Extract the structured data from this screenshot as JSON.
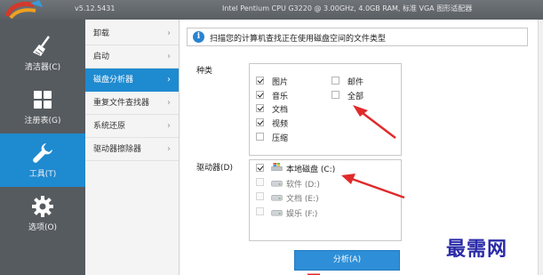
{
  "titlebar": {
    "version": "v5.12.5431",
    "system_info": "Intel Pentium CPU G3220 @ 3.00GHz, 4.0GB RAM, 标准 VGA 图形适配器"
  },
  "sidebar": {
    "items": [
      {
        "label": "清洁器(C)",
        "icon": "broom-icon"
      },
      {
        "label": "注册表(G)",
        "icon": "grid-icon"
      },
      {
        "label": "工具(T)",
        "icon": "wrench-icon",
        "active": true
      },
      {
        "label": "选项(O)",
        "icon": "gear-icon"
      }
    ]
  },
  "subnav": {
    "items": [
      {
        "label": "卸载"
      },
      {
        "label": "启动"
      },
      {
        "label": "磁盘分析器",
        "active": true
      },
      {
        "label": "重复文件查找器"
      },
      {
        "label": "系统还原"
      },
      {
        "label": "驱动器擦除器"
      }
    ]
  },
  "info": {
    "text": "扫描您的计算机查找正在使用磁盘空间的文件类型"
  },
  "categories": {
    "label": "种类",
    "left": [
      {
        "label": "图片",
        "checked": true
      },
      {
        "label": "音乐",
        "checked": true
      },
      {
        "label": "文档",
        "checked": true
      },
      {
        "label": "视频",
        "checked": true
      },
      {
        "label": "压缩",
        "checked": false
      }
    ],
    "right": [
      {
        "label": "邮件",
        "checked": false
      },
      {
        "label": "全部",
        "checked": false
      }
    ]
  },
  "drives": {
    "label": "驱动器(D)",
    "items": [
      {
        "label": "本地磁盘 (C:)",
        "checked": true,
        "enabled": true,
        "icon": "windows-drive-icon"
      },
      {
        "label": "软件 (D:)",
        "checked": false,
        "enabled": false,
        "icon": "drive-icon"
      },
      {
        "label": "文档 (E:)",
        "checked": false,
        "enabled": false,
        "icon": "drive-icon"
      },
      {
        "label": "娱乐 (F:)",
        "checked": false,
        "enabled": false,
        "icon": "drive-icon"
      }
    ]
  },
  "actions": {
    "analyze_label": "分析(A)"
  },
  "watermark": {
    "text": "最需网"
  },
  "colors": {
    "accent": "#1e8ad0",
    "annotation_arrow": "#e02a2a",
    "sidebar": "#565b60"
  }
}
